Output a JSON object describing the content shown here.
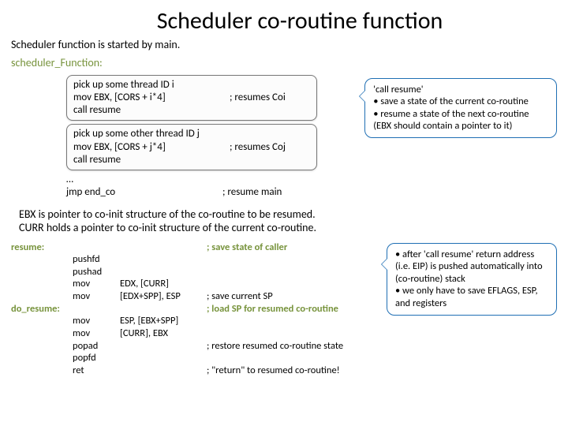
{
  "title": "Scheduler co-routine function",
  "subtitle": "Scheduler function is started by main.",
  "label1": "scheduler_Function:",
  "box1": {
    "l1": "pick up some thread ID i",
    "l2a": "mov EBX, [CORS + i*4]",
    "l2c": "; resumes Coi",
    "l3": "call resume"
  },
  "box2": {
    "l1": "pick up some other thread ID j",
    "l2a": "mov EBX, [CORS + j*4]",
    "l2c": "; resumes Coj",
    "l3": "call resume"
  },
  "trail": {
    "l1": "…",
    "l2a": "jmp end_co",
    "l2c": "; resume main"
  },
  "bubble1": {
    "t1": "'call resume'",
    "t2": "• save a state of the current co-routine",
    "t3": "• resume a state of the next co-routine (EBX should contain a pointer to it)"
  },
  "mid1": "EBX is pointer to co-init structure of the co-routine to be resumed.",
  "mid2": "CURR holds a pointer to co-init structure of the current co-routine.",
  "asm": {
    "r1": {
      "lbl": "resume:",
      "op": "",
      "arg": "",
      "cmt": "; save state of caller"
    },
    "r2": {
      "lbl": "",
      "op": "pushfd",
      "arg": "",
      "cmt": ""
    },
    "r3": {
      "lbl": "",
      "op": "pushad",
      "arg": "",
      "cmt": ""
    },
    "r4": {
      "lbl": "",
      "op": "mov",
      "arg": "EDX, [CURR]",
      "cmt": ""
    },
    "r5": {
      "lbl": "",
      "op": "mov",
      "arg": "[EDX+SPP], ESP",
      "cmt": "; save current SP"
    },
    "r6": {
      "lbl": "do_resume:",
      "op": "",
      "arg": "",
      "cmt": "; load SP for resumed co-routine"
    },
    "r7": {
      "lbl": "",
      "op": "mov",
      "arg": "ESP, [EBX+SPP]",
      "cmt": ""
    },
    "r8": {
      "lbl": "",
      "op": "mov",
      "arg": "[CURR], EBX",
      "cmt": ""
    },
    "r9": {
      "lbl": "",
      "op": "popad",
      "arg": "",
      "cmt": "; restore resumed co-routine state"
    },
    "r10": {
      "lbl": "",
      "op": "popfd",
      "arg": "",
      "cmt": ""
    },
    "r11": {
      "lbl": "",
      "op": "ret",
      "arg": "",
      "cmt": "; \"return\" to resumed co-routine!"
    }
  },
  "bubble2": {
    "t1": "• after 'call resume' return address (i.e. EIP) is pushed automatically into (co-routine) stack",
    "t2": "• we only have to save EFLAGS, ESP, and registers"
  }
}
